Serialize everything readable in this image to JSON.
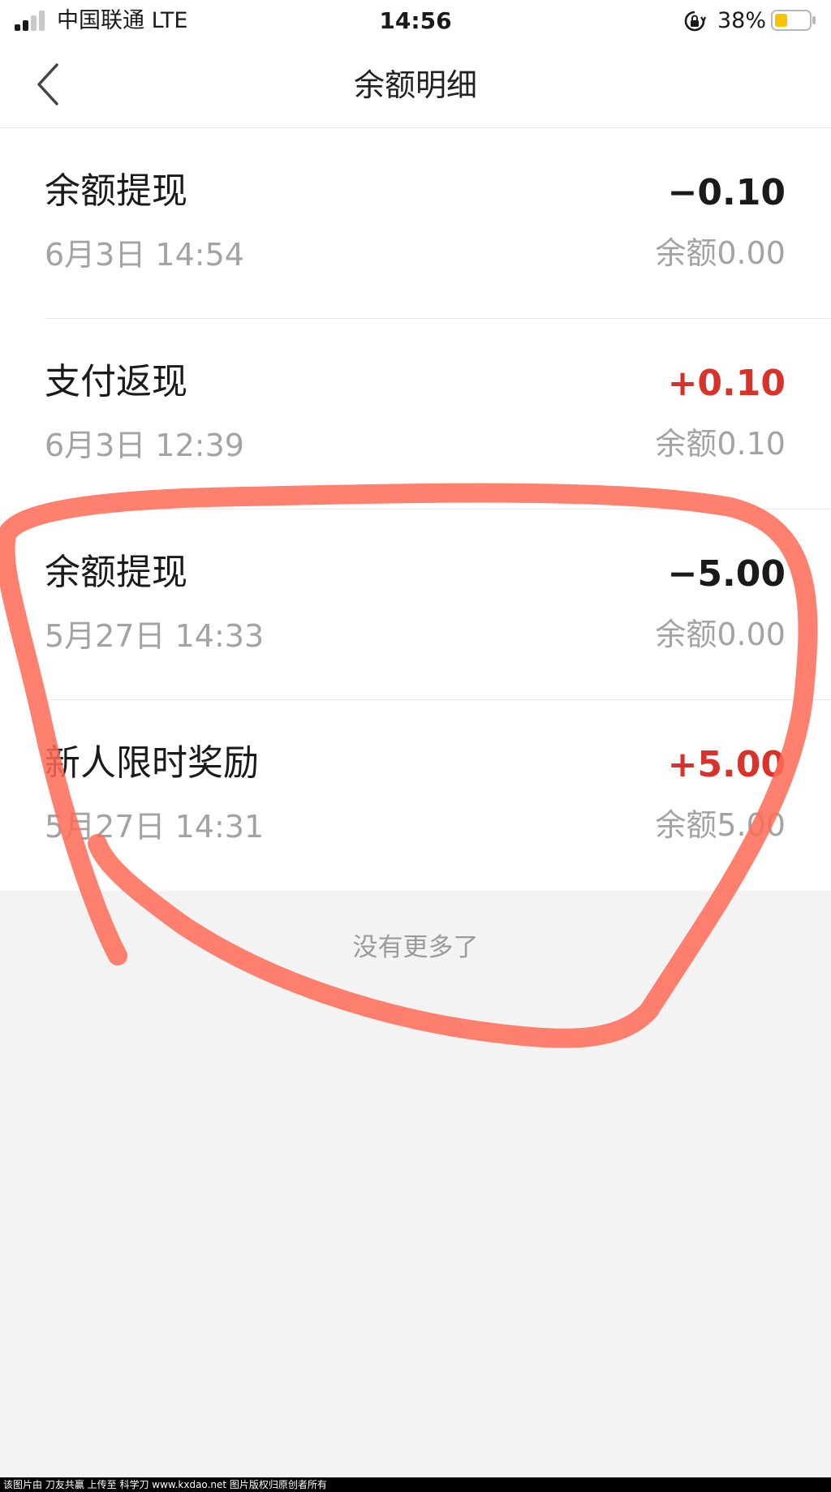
{
  "status_bar": {
    "carrier": "中国联通  LTE",
    "time": "14:56",
    "battery_percent": "38%",
    "signal_icon": "cellular-signal-icon",
    "lock_icon": "rotation-lock-icon",
    "battery_icon": "battery-icon"
  },
  "nav": {
    "title": "余额明细",
    "back_icon": "chevron-left-icon"
  },
  "transactions": [
    {
      "title": "余额提现",
      "amount": "−0.10",
      "time": "6月3日 14:54",
      "balance": "余额0.00",
      "type": "debit"
    },
    {
      "title": "支付返现",
      "amount": "+0.10",
      "time": "6月3日 12:39",
      "balance": "余额0.10",
      "type": "credit"
    },
    {
      "title": "余额提现",
      "amount": "−5.00",
      "time": "5月27日 14:33",
      "balance": "余额0.00",
      "type": "debit"
    },
    {
      "title": "新人限时奖励",
      "amount": "+5.00",
      "time": "5月27日 14:31",
      "balance": "余额5.00",
      "type": "credit"
    }
  ],
  "footer_note": "没有更多了",
  "watermark": "该图片由 刀友共赢 上传至 科学刀 www.kxdao.net 图片版权归原创者所有",
  "colors": {
    "credit": "#d9322a",
    "debit": "#1a1a1a",
    "annotation": "#ff6a55",
    "page_bg": "#f3f3f3"
  }
}
